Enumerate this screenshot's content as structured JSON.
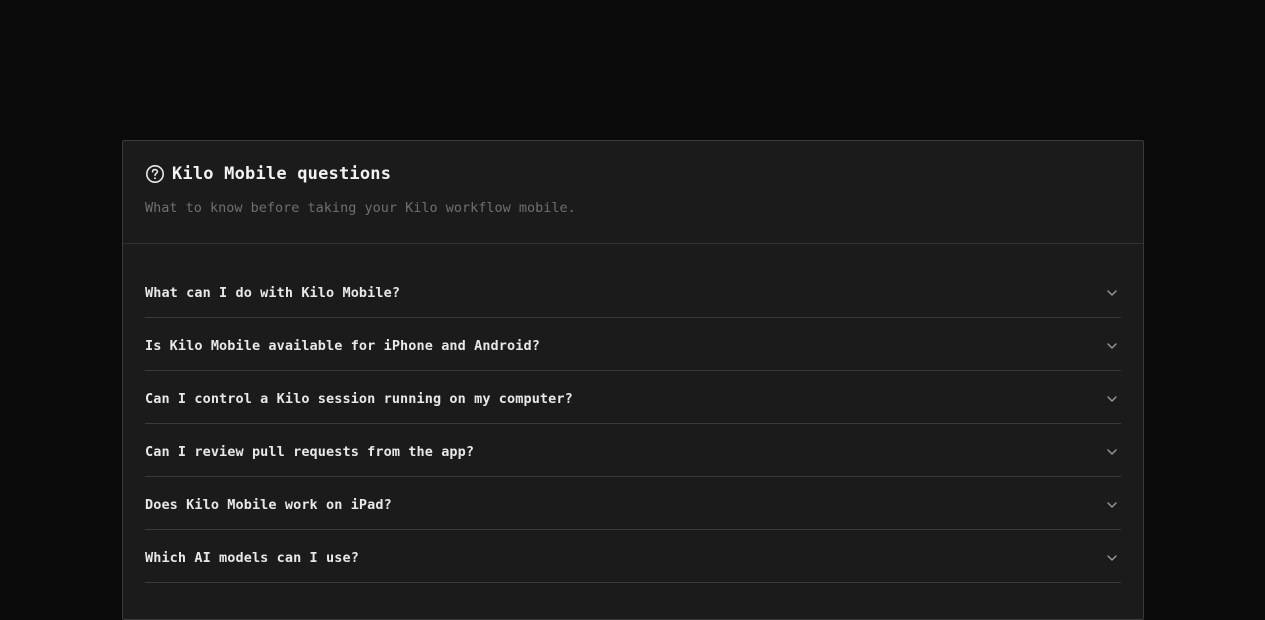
{
  "header": {
    "title": "Kilo Mobile questions",
    "subtitle": "What to know before taking your Kilo workflow mobile.",
    "icon": "help-circle-icon"
  },
  "faq": {
    "items": [
      {
        "question": "What can I do with Kilo Mobile?"
      },
      {
        "question": "Is Kilo Mobile available for iPhone and Android?"
      },
      {
        "question": "Can I control a Kilo session running on my computer?"
      },
      {
        "question": "Can I review pull requests from the app?"
      },
      {
        "question": "Does Kilo Mobile work on iPad?"
      },
      {
        "question": "Which AI models can I use?"
      }
    ],
    "expand_icon": "chevron-down-icon"
  },
  "colors": {
    "page_bg": "#0a0a0a",
    "card_bg": "#1b1b1b",
    "border": "#3a3a3a",
    "title": "#f2f2f2",
    "subtitle": "#6f6f6f"
  }
}
